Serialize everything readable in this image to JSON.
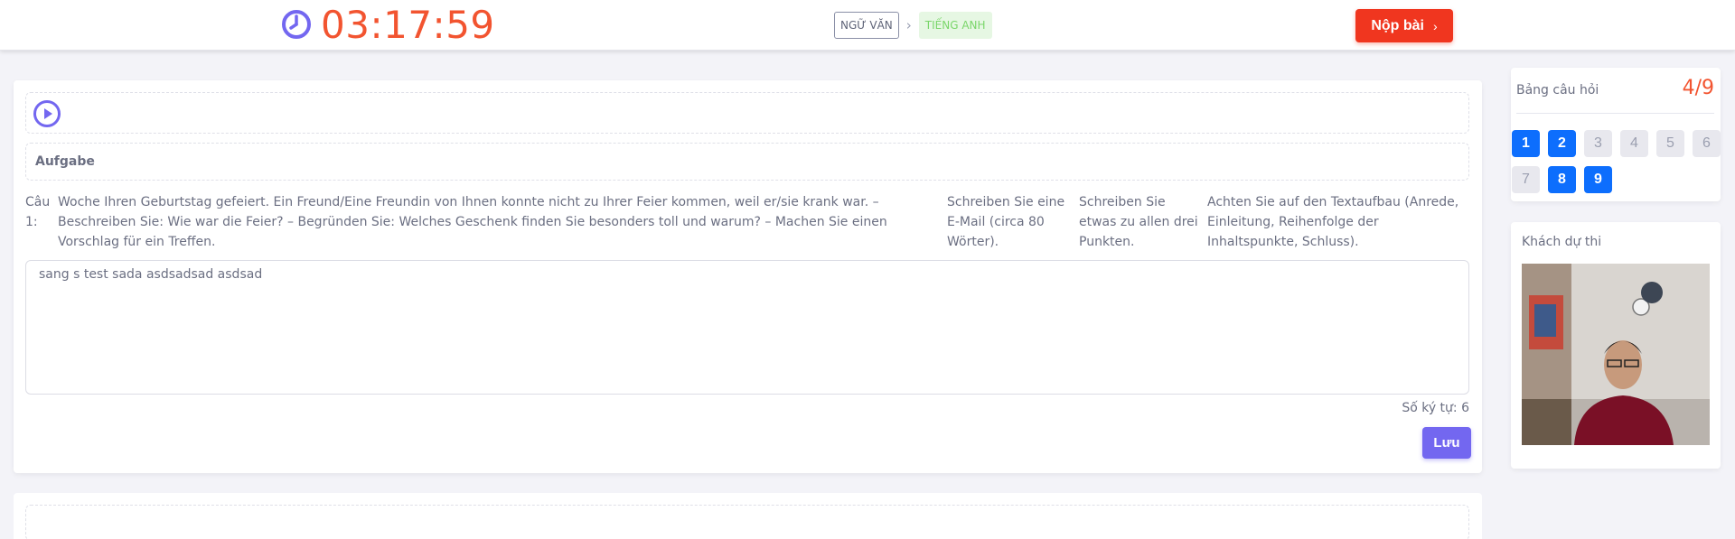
{
  "header": {
    "timer": "03:17:59",
    "crumb_from": "NGỮ VĂN",
    "crumb_to": "TIẾNG ANH",
    "submit_label": "Nộp bài"
  },
  "task": {
    "section_title": "Aufgabe",
    "question_label": "Câu 1:",
    "question_text": "Woche Ihren Geburtstag gefeiert. Ein Freund/Eine Freundin von Ihnen konnte nicht zu Ihrer Feier kommen, weil er/sie krank war. – Beschreiben Sie: Wie war die Feier? – Begründen Sie: Welches Geschenk finden Sie besonders toll und warum? – Machen Sie einen Vorschlag für ein Treffen.",
    "col2": "Schreiben Sie eine E-Mail (circa 80 Wörter).",
    "col3": "Schreiben Sie etwas zu allen drei Punkten.",
    "col4": "Achten Sie auf den Textaufbau (Anrede, Einleitung, Reihenfolge der Inhaltspunkte, Schluss).",
    "answer": "sang s test sada asdsadsad asdsad",
    "char_count_label": "Số ký tự: 6",
    "save_label": "Lưu"
  },
  "board": {
    "title": "Bảng câu hỏi",
    "progress": "4/9",
    "questions": [
      {
        "n": "1",
        "done": true
      },
      {
        "n": "2",
        "done": true
      },
      {
        "n": "3",
        "done": false
      },
      {
        "n": "4",
        "done": false
      },
      {
        "n": "5",
        "done": false
      },
      {
        "n": "6",
        "done": false
      },
      {
        "n": "7",
        "done": false
      },
      {
        "n": "8",
        "done": true
      },
      {
        "n": "9",
        "done": true
      }
    ]
  },
  "candidate": {
    "title": "Khách dự thi"
  },
  "colors": {
    "accent_red": "#f25430",
    "submit_red": "#f0361f",
    "primary_purple": "#7367f0",
    "answered_blue": "#0d6efd",
    "crumb_green": "#7ad66a"
  }
}
